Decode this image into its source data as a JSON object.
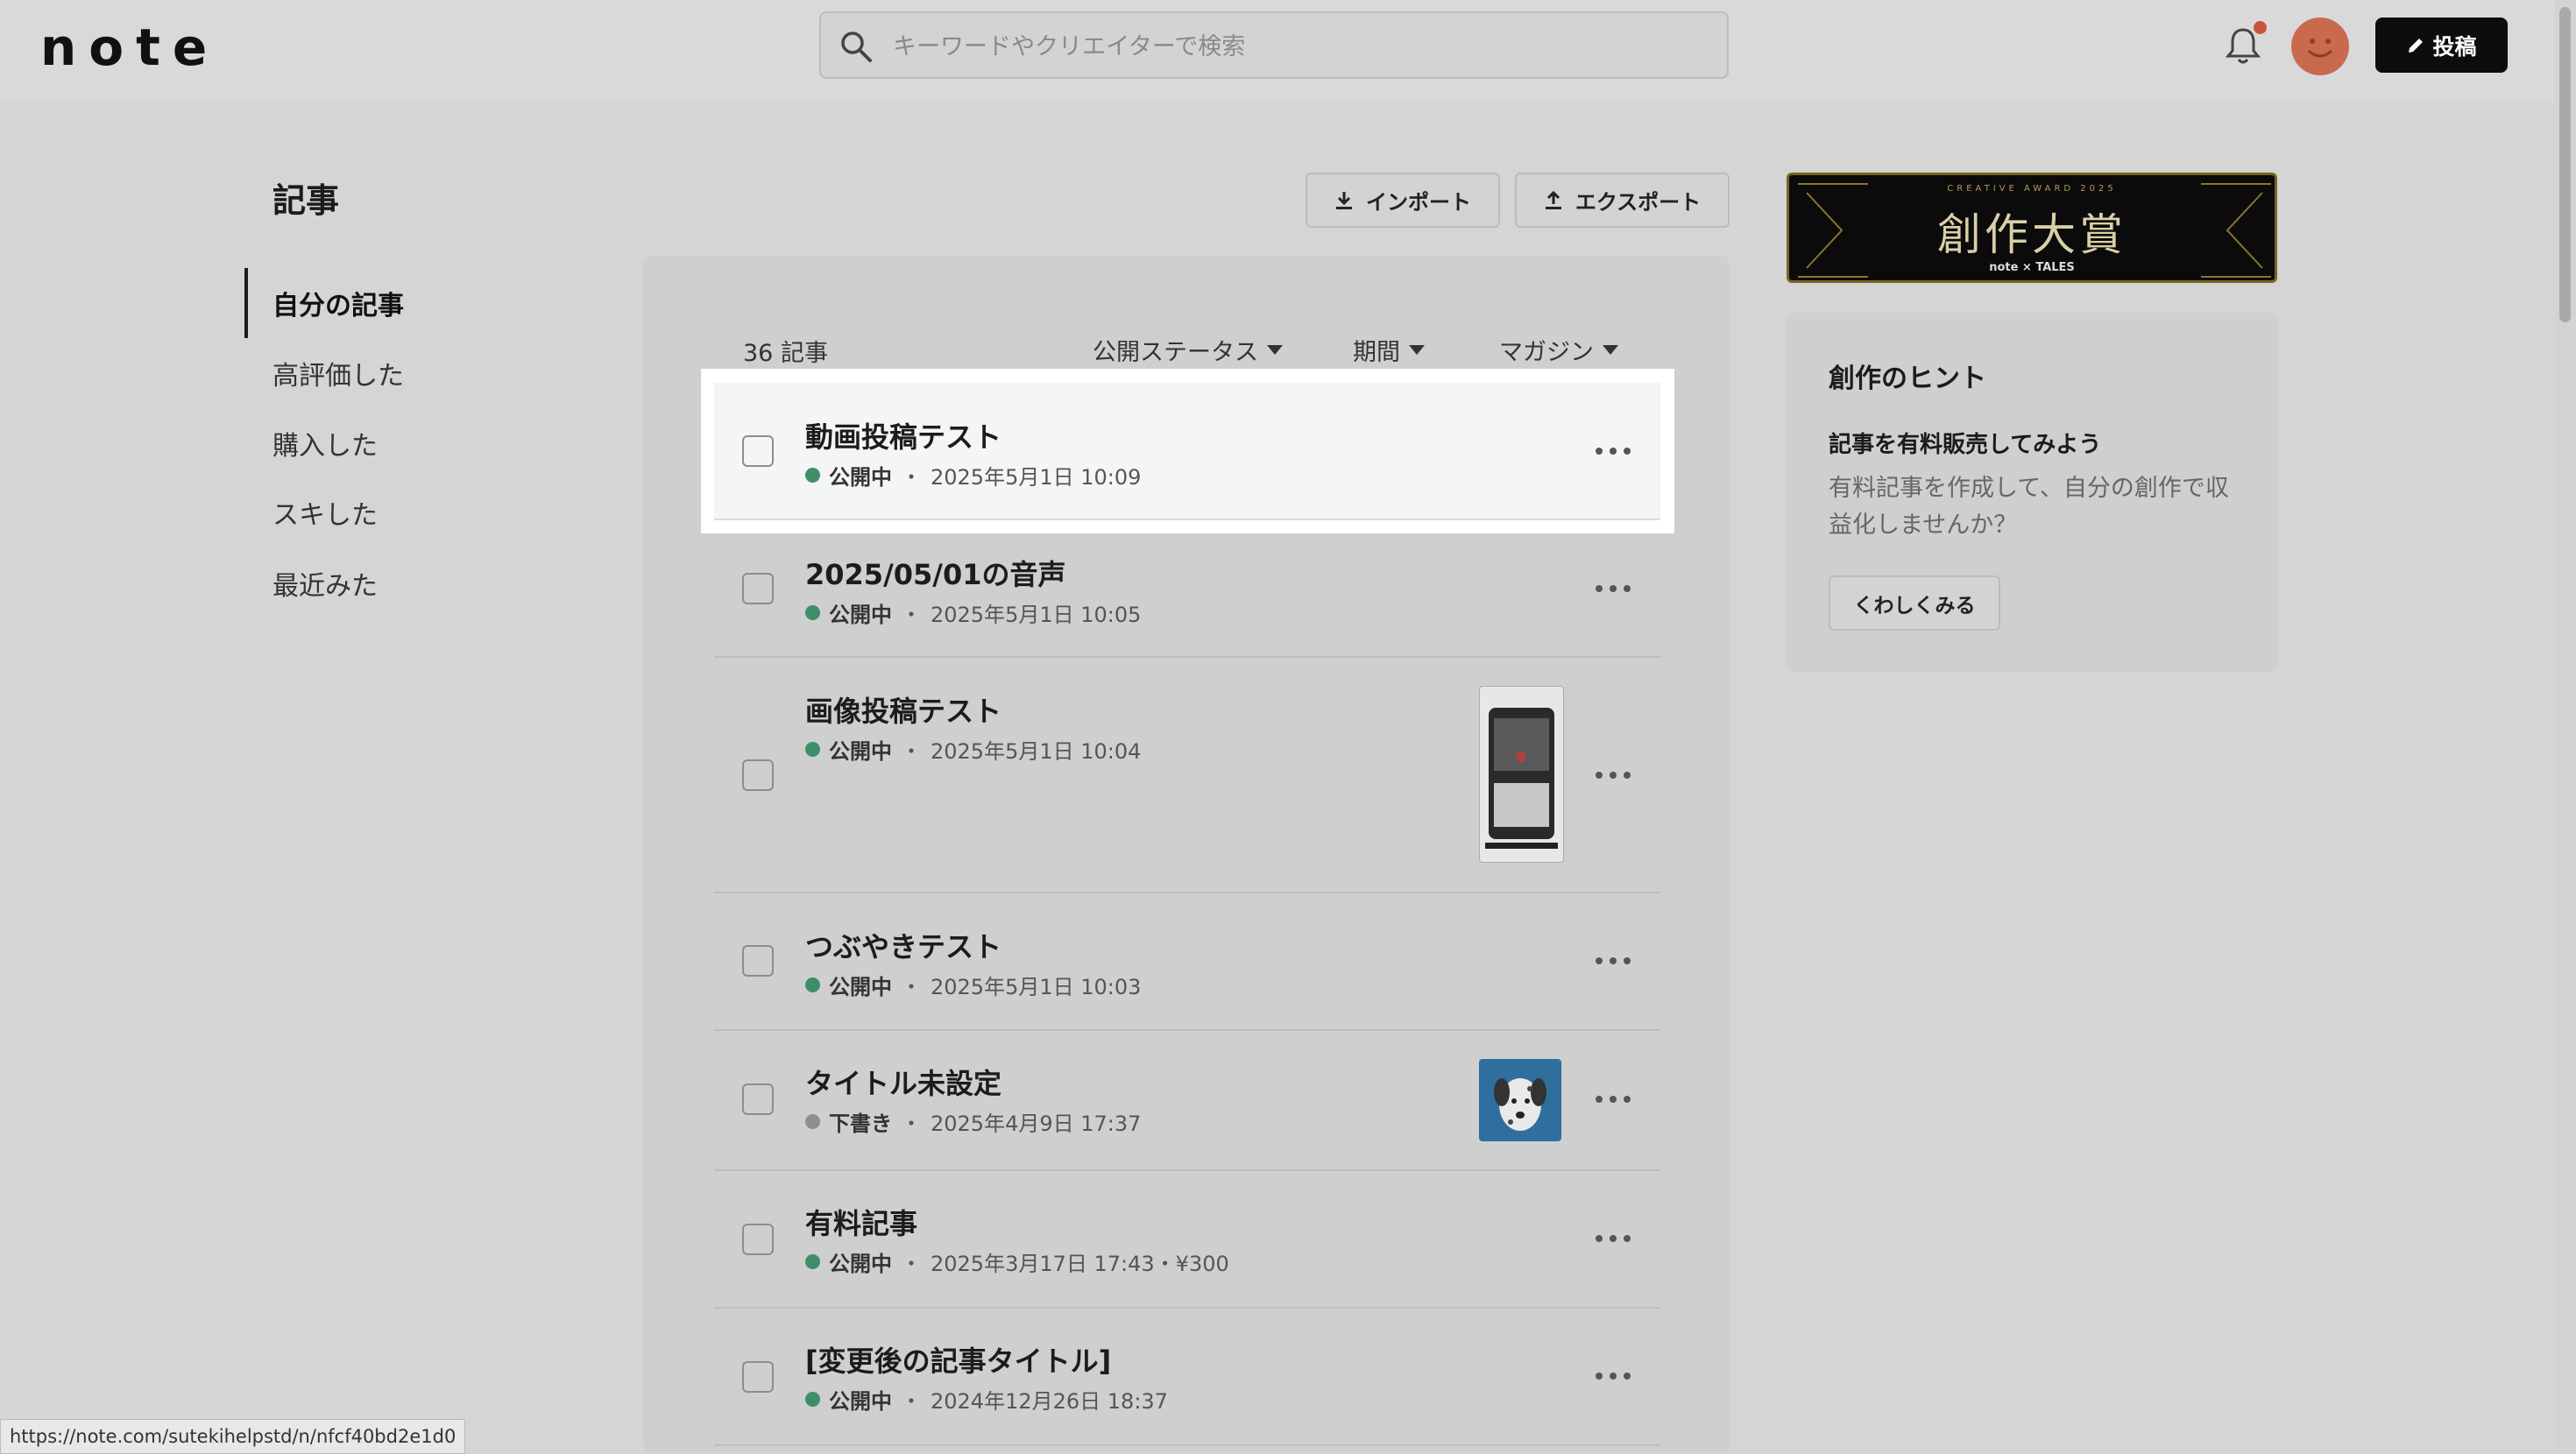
{
  "header": {
    "logo": "note",
    "search_placeholder": "キーワードやクリエイターで検索",
    "post_label": "投稿"
  },
  "sidebar": {
    "title": "記事",
    "items": [
      {
        "label": "自分の記事",
        "active": true
      },
      {
        "label": "高評価した"
      },
      {
        "label": "購入した"
      },
      {
        "label": "スキした"
      },
      {
        "label": "最近みた"
      }
    ]
  },
  "actions": {
    "import_label": "インポート",
    "export_label": "エクスポート"
  },
  "list": {
    "count": "36 記事",
    "filters": [
      "公開ステータス",
      "期間",
      "マガジン"
    ],
    "rows": [
      {
        "title": "動画投稿テスト",
        "status": "公開中",
        "date": "2025年5月1日 10:09",
        "status_color": "#3e8e6a"
      },
      {
        "title": "2025/05/01の音声",
        "status": "公開中",
        "date": "2025年5月1日 10:05",
        "status_color": "#3e8e6a"
      },
      {
        "title": "画像投稿テスト",
        "status": "公開中",
        "date": "2025年5月1日 10:04",
        "status_color": "#3e8e6a",
        "thumbnail": "phone-screenshot"
      },
      {
        "title": "つぶやきテスト",
        "status": "公開中",
        "date": "2025年5月1日 10:03",
        "status_color": "#3e8e6a"
      },
      {
        "title": "タイトル未設定",
        "status": "下書き",
        "date": "2025年4月9日 17:37",
        "status_color": "#8f8f8f",
        "thumbnail": "dalmatian-image"
      },
      {
        "title": "有料記事",
        "status": "公開中",
        "date": "2025年3月17日 17:43・¥300",
        "status_color": "#3e8e6a"
      },
      {
        "title": "[変更後の記事タイトル]",
        "status": "公開中",
        "date": "2024年12月26日 18:37",
        "status_color": "#3e8e6a"
      }
    ]
  },
  "banner": {
    "small": "CREATIVE AWARD 2025",
    "main": "創作大賞",
    "sub": "note × TALES"
  },
  "hint": {
    "title": "創作のヒント",
    "subtitle": "記事を有料販売してみよう",
    "body": "有料記事を作成して、自分の創作で収益化しませんか？",
    "button": "くわしくみる"
  },
  "statusbar": {
    "url": "https://note.com/sutekihelpstd/n/nfcf40bd2e1d0"
  }
}
